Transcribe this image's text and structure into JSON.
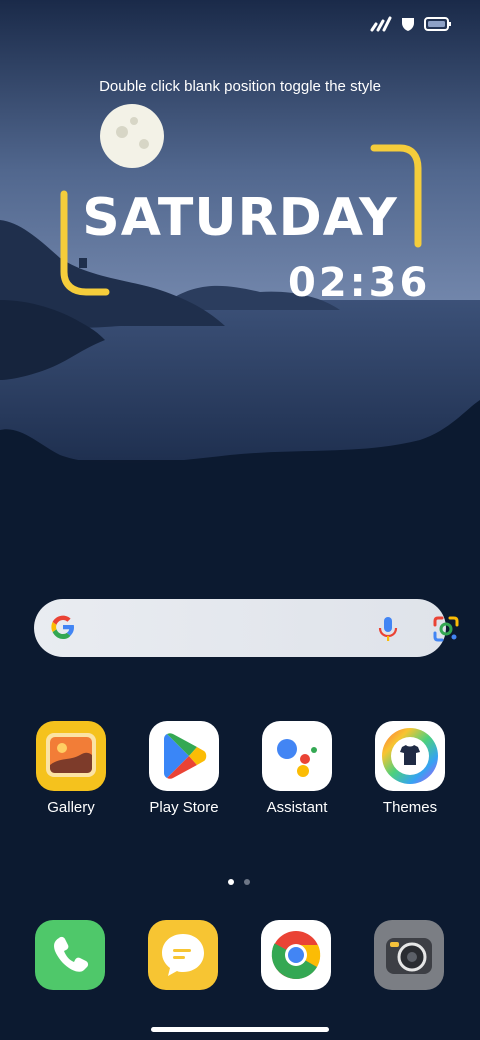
{
  "hint_text": "Double click blank position toggle the style",
  "clock": {
    "day": "SATURDAY",
    "time": "02:36"
  },
  "search": {
    "icons": [
      "google-g-icon",
      "microphone-icon",
      "google-lens-icon"
    ]
  },
  "apps": [
    {
      "label": "Gallery",
      "icon": "gallery-icon"
    },
    {
      "label": "Play Store",
      "icon": "play-store-icon"
    },
    {
      "label": "Assistant",
      "icon": "assistant-icon"
    },
    {
      "label": "Themes",
      "icon": "themes-icon"
    }
  ],
  "dock": [
    {
      "name": "Phone",
      "icon": "phone-icon"
    },
    {
      "name": "Messages",
      "icon": "messages-icon"
    },
    {
      "name": "Chrome",
      "icon": "chrome-icon"
    },
    {
      "name": "Camera",
      "icon": "camera-icon"
    }
  ],
  "page_indicator": {
    "pages": 2,
    "current": 1
  },
  "colors": {
    "accent_yellow": "#f5cd3b",
    "sky_top": "#182a49",
    "ground": "#0c1a30"
  }
}
